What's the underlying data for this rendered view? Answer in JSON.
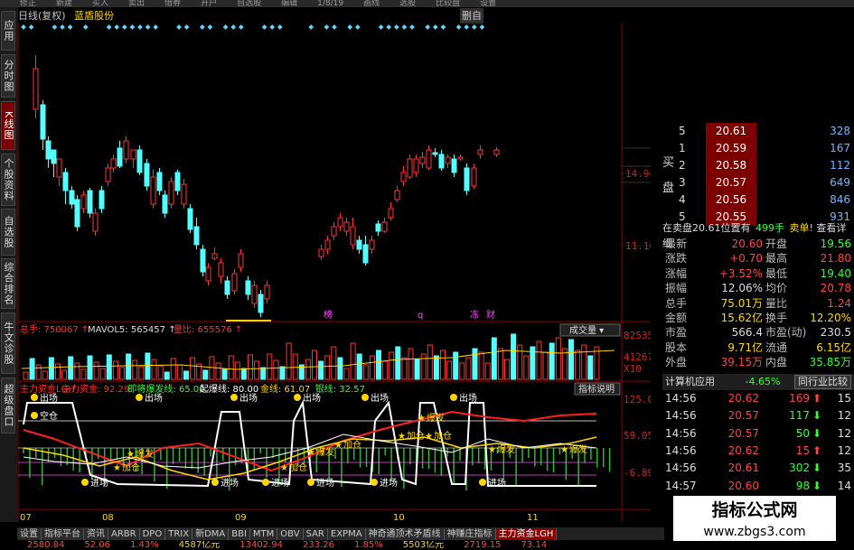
{
  "top_menu": [
    "修正",
    "新建",
    "买入",
    "卖出",
    "借券",
    "开户",
    "自选股",
    "编辑",
    "1/8/19",
    "画线",
    "选股",
    "比较盘",
    "设置"
  ],
  "chart_title": {
    "mode": "日线(复权)",
    "stock": "蓝盾股份",
    "right": "删自"
  },
  "left_tabs": [
    {
      "label": "应用",
      "active": false
    },
    {
      "label": "分时图",
      "active": false
    },
    {
      "label": "K线图",
      "active": true
    },
    {
      "label": "个股资料",
      "active": false
    },
    {
      "label": "自选股",
      "active": false
    },
    {
      "label": "综合排名",
      "active": false
    },
    {
      "label": "牛文诊股",
      "active": false
    },
    {
      "label": "超级盘口",
      "active": false
    }
  ],
  "price_axis": {
    "labels": [
      "14.94",
      "11.16"
    ],
    "color": "#cc2222"
  },
  "event_marks": [
    "榜",
    "q",
    "冻",
    "财"
  ],
  "volume_header": {
    "total": "总手: 750067",
    "mavol": "MAVOL5: 565457",
    "ratio": "量比: 655576",
    "button": "成交量"
  },
  "volume_axis": {
    "labels": [
      "82535",
      "41267",
      "X10"
    ]
  },
  "indicator_header": {
    "items": [
      {
        "text": "主力资金LGH",
        "color": "#ff3030"
      },
      {
        "text": "主力资金: 92.29",
        "color": "#ff3030"
      },
      {
        "text": "即将爆发线: 65.00",
        "color": "#30ff30"
      },
      {
        "text": "起爆线: 80.00",
        "color": "#ffffff"
      },
      {
        "text": "金线: 61.07",
        "color": "#ffd700"
      },
      {
        "text": "银线: 32.57",
        "color": "#30ff30"
      }
    ],
    "button": "指标说明"
  },
  "indicator_axis": {
    "labels": [
      "125.00",
      "59.05",
      "-6.89"
    ]
  },
  "signals": [
    "出场",
    "出场",
    "出场",
    "出场",
    "出场",
    "出场",
    "空仓",
    "进场",
    "进场",
    "进场",
    "进场",
    "进场",
    "进场",
    "爆发",
    "爆发",
    "爆发",
    "加仓",
    "加仓",
    "加仓",
    "加仓",
    "加仓",
    "爆发",
    "爆发"
  ],
  "date_axis": [
    "07",
    "08",
    "09",
    "10",
    "11"
  ],
  "orderbook": {
    "sell_label": "买",
    "buy_label": "买盘",
    "rows": [
      {
        "level": "5",
        "price": "20.61",
        "vol": "328"
      },
      {
        "level": "1",
        "price": "20.59",
        "vol": "167"
      },
      {
        "level": "2",
        "price": "20.58",
        "vol": "112"
      },
      {
        "level": "3",
        "price": "20.57",
        "vol": "649"
      },
      {
        "level": "4",
        "price": "20.56",
        "vol": "846"
      },
      {
        "level": "5",
        "price": "20.55",
        "vol": "931"
      }
    ]
  },
  "status_bar": {
    "left": "在卖盘20.61位置有",
    "amount": "499手",
    "sell": "卖单!",
    "detail": "查看详细"
  },
  "stats": [
    {
      "k1": "最新",
      "v1": "20.60",
      "c1": "#ff4444",
      "k2": "开盘",
      "v2": "19.56",
      "c2": "#30ff30"
    },
    {
      "k1": "涨跌",
      "v1": "+0.70",
      "c1": "#ff4444",
      "k2": "最高",
      "v2": "21.80",
      "c2": "#ff4444"
    },
    {
      "k1": "涨幅",
      "v1": "+3.52%",
      "c1": "#ff4444",
      "k2": "最低",
      "v2": "19.40",
      "c2": "#30ff30"
    },
    {
      "k1": "振幅",
      "v1": "12.06%",
      "c1": "#dddddd",
      "k2": "均价",
      "v2": "20.78",
      "c2": "#ff4444"
    },
    {
      "k1": "总手",
      "v1": "75.01万",
      "c1": "#ffd700",
      "k2": "量比",
      "v2": "1.24",
      "c2": "#ff4444"
    },
    {
      "k1": "金额",
      "v1": "15.62亿",
      "c1": "#ffd700",
      "k2": "换手",
      "v2": "12.20%",
      "c2": "#ffd700"
    },
    {
      "k1": "市盈",
      "v1": "566.4",
      "c1": "#dddddd",
      "k2": "市盈(动)",
      "v2": "230.5",
      "c2": "#dddddd"
    },
    {
      "k1": "股本",
      "v1": "9.71亿",
      "c1": "#ffd700",
      "k2": "流通",
      "v2": "6.15亿",
      "c2": "#ffd700"
    },
    {
      "k1": "外盘",
      "v1": "39.15万",
      "c1": "#ff4444",
      "k2": "内盘",
      "v2": "35.85万",
      "c2": "#30ff30"
    }
  ],
  "calc_bar": {
    "label": "计算机应用",
    "change": "-4.65%",
    "button": "同行业比较"
  },
  "ticks": [
    {
      "time": "14:56",
      "price": "20.62",
      "vol": "169",
      "dir": "up",
      "count": "15"
    },
    {
      "time": "14:56",
      "price": "20.57",
      "vol": "117",
      "dir": "down",
      "count": "12"
    },
    {
      "time": "14:56",
      "price": "20.57",
      "vol": "50",
      "dir": "down",
      "count": "12"
    },
    {
      "time": "14:56",
      "price": "20.62",
      "vol": "15",
      "dir": "up",
      "count": "12"
    },
    {
      "time": "14:56",
      "price": "20.61",
      "vol": "302",
      "dir": "down",
      "count": "35"
    },
    {
      "time": "14:57",
      "price": "20.60",
      "vol": "98",
      "dir": "down",
      "count": "14"
    }
  ],
  "watermark": {
    "line1": "指标公式网",
    "line2": "www.zbgs3.com"
  },
  "bottom_tabs": [
    {
      "label": "设置",
      "active": false
    },
    {
      "label": "指标平台",
      "active": false
    },
    {
      "label": "资讯",
      "active": false
    },
    {
      "label": "ARBR",
      "active": false
    },
    {
      "label": "DPO",
      "active": false
    },
    {
      "label": "TRIX",
      "active": false
    },
    {
      "label": "新DMA",
      "active": false
    },
    {
      "label": "BBI",
      "active": false
    },
    {
      "label": "MTM",
      "active": false
    },
    {
      "label": "OBV",
      "active": false
    },
    {
      "label": "SAR",
      "active": false
    },
    {
      "label": "EXPMA",
      "active": false
    },
    {
      "label": "神奇通顶术矛盾线",
      "active": false
    },
    {
      "label": "神赚庄指标",
      "active": false
    },
    {
      "label": "主力资金LGH",
      "active": true
    }
  ],
  "bottom_bar": [
    "2580.84",
    "52.06",
    "1.43%",
    "4587亿元",
    "13402.94",
    "233.26",
    "1.85%",
    "5503亿元",
    "2719.15",
    "73.14"
  ],
  "colors": {
    "up": "#ff3333",
    "down": "#54ffff",
    "panel_border": "#8b0000"
  }
}
